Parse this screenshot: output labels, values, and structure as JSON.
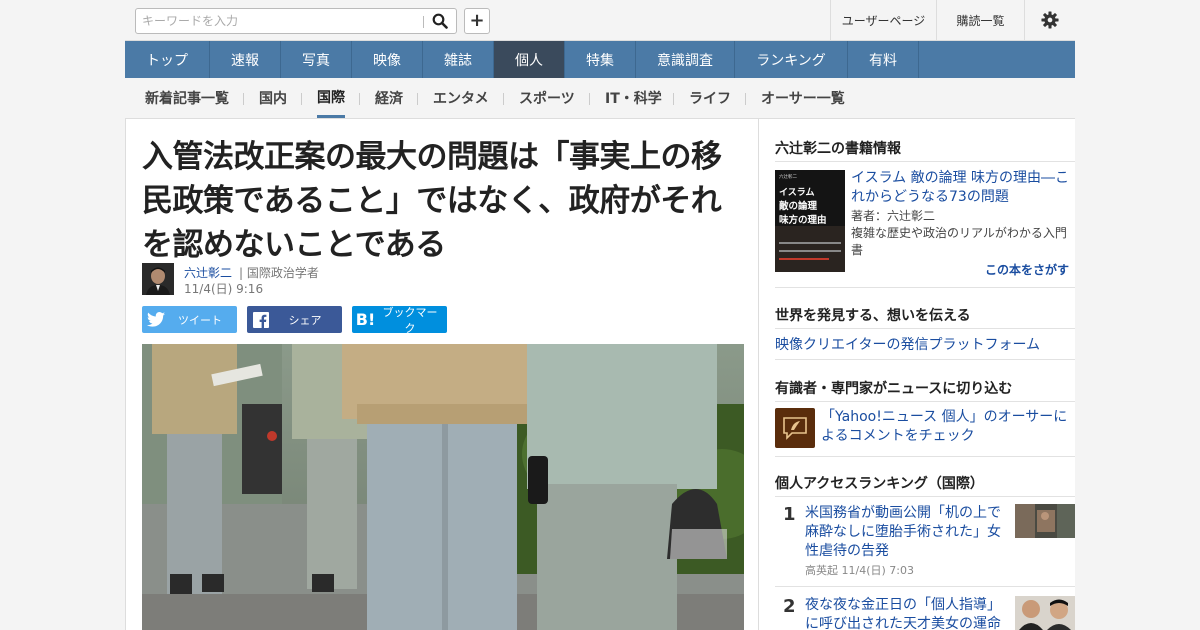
{
  "search": {
    "placeholder": "キーワードを入力"
  },
  "header_links": {
    "user_page": "ユーザーページ",
    "subscriptions": "購読一覧"
  },
  "main_nav": [
    "トップ",
    "速報",
    "写真",
    "映像",
    "雑誌",
    "個人",
    "特集",
    "意識調査",
    "ランキング",
    "有料"
  ],
  "main_nav_active": "個人",
  "sub_nav": [
    "新着記事一覧",
    "国内",
    "国際",
    "経済",
    "エンタメ",
    "スポーツ",
    "IT・科学",
    "ライフ",
    "オーサー一覧"
  ],
  "sub_nav_active": "国際",
  "article": {
    "title": "入管法改正案の最大の問題は「事実上の移民政策であること」ではなく、政府がそれを認めないことである",
    "author_name": "六辻彰二",
    "author_title": "| 国際政治学者",
    "date": "11/4(日) 9:16"
  },
  "share": {
    "twitter": "ツイート",
    "facebook": "シェア",
    "hatena": "ブックマーク"
  },
  "sidebar": {
    "books_heading": "六辻彰二の書籍情報",
    "book": {
      "cover_text": "イスラム 敵の論理 味方の理由",
      "title": "イスラム 敵の論理 味方の理由―これからどうなる73の問題",
      "author": "著者：六辻彰二",
      "description": "複雑な歴史や政治のリアルがわかる入門書",
      "find_link": "この本をさがす"
    },
    "creator_heading": "世界を発見する、想いを伝える",
    "creator_link": "映像クリエイターの発信プラットフォーム",
    "expert_heading": "有識者・専門家がニュースに切り込む",
    "expert_link": "「Yahoo!ニュース 個人」のオーサーによるコメントをチェック",
    "ranking_heading": "個人アクセスランキング（国際）",
    "ranking": [
      {
        "rank": "1",
        "title": "米国務省が動画公開「机の上で麻酔なしに堕胎手術された」女性虐待の告発",
        "meta": "高英起 11/4(日) 7:03"
      },
      {
        "rank": "2",
        "title": "夜な夜な金正日の「個人指導」に呼び出された天才美女の運命",
        "meta": ""
      }
    ]
  },
  "colors": {
    "nav": "#4b7aa6",
    "nav_active": "#3a4a5c",
    "link": "#1a4da0",
    "twitter": "#55acee",
    "facebook": "#3b5998",
    "hatena": "#008fde"
  }
}
